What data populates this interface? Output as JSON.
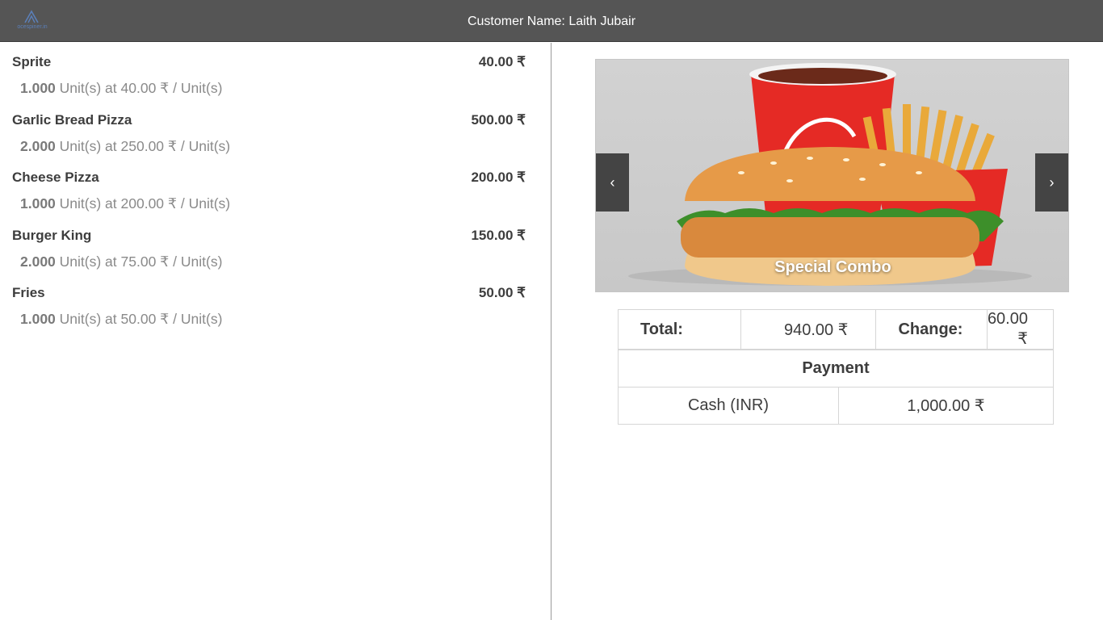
{
  "header": {
    "logo_text": "ocespiner.in",
    "customer_label": "Customer Name: Laith Jubair"
  },
  "orderlines": [
    {
      "name": "Sprite",
      "price": "40.00 ₹",
      "qty": "1.000",
      "detail": " Unit(s) at 40.00 ₹ / Unit(s)"
    },
    {
      "name": "Garlic Bread Pizza",
      "price": "500.00 ₹",
      "qty": "2.000",
      "detail": " Unit(s) at 250.00 ₹ / Unit(s)"
    },
    {
      "name": "Cheese Pizza",
      "price": "200.00 ₹",
      "qty": "1.000",
      "detail": " Unit(s) at 200.00 ₹ / Unit(s)"
    },
    {
      "name": "Burger King",
      "price": "150.00 ₹",
      "qty": "2.000",
      "detail": " Unit(s) at 75.00 ₹ / Unit(s)"
    },
    {
      "name": "Fries",
      "price": "50.00 ₹",
      "qty": "1.000",
      "detail": " Unit(s) at 50.00 ₹ / Unit(s)"
    }
  ],
  "slider": {
    "caption": "Special Combo",
    "prev_icon": "‹",
    "next_icon": "›"
  },
  "summary": {
    "total_label": "Total:",
    "total_value": "940.00 ₹",
    "change_label": "Change:",
    "change_value": "60.00 ₹"
  },
  "payment": {
    "heading": "Payment",
    "method": "Cash (INR)",
    "amount": "1,000.00 ₹"
  },
  "colors": {
    "header_bg": "#555555",
    "accent_red": "#e52a25",
    "text": "#3d3d3d",
    "muted": "#8a8a8a"
  }
}
